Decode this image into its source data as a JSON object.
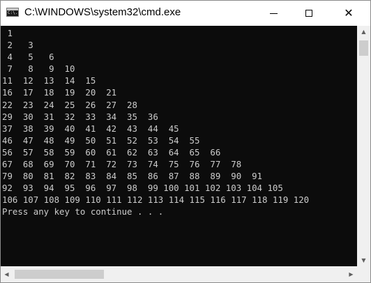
{
  "window": {
    "title": "C:\\WINDOWS\\system32\\cmd.exe",
    "icon_text": "C:\\."
  },
  "controls": {
    "minimize_icon": "minimize-icon",
    "maximize_icon": "maximize-icon",
    "close_glyph": "✕"
  },
  "console": {
    "lines": [
      " 1",
      " 2   3",
      " 4   5   6",
      " 7   8   9  10",
      "11  12  13  14  15",
      "16  17  18  19  20  21",
      "22  23  24  25  26  27  28",
      "29  30  31  32  33  34  35  36",
      "37  38  39  40  41  42  43  44  45",
      "46  47  48  49  50  51  52  53  54  55",
      "56  57  58  59  60  61  62  63  64  65  66",
      "67  68  69  70  71  72  73  74  75  76  77  78",
      "79  80  81  82  83  84  85  86  87  88  89  90  91",
      "92  93  94  95  96  97  98  99 100 101 102 103 104 105",
      "106 107 108 109 110 111 112 113 114 115 116 117 118 119 120",
      "Press any key to continue . . ."
    ]
  },
  "scrollbars": {
    "up_glyph": "▲",
    "down_glyph": "▼",
    "left_glyph": "◀",
    "right_glyph": "▶"
  },
  "colors": {
    "console_bg": "#0c0c0c",
    "console_text": "#cccccc",
    "titlebar_bg": "#ffffff",
    "scrollbar_bg": "#f0f0f0"
  }
}
